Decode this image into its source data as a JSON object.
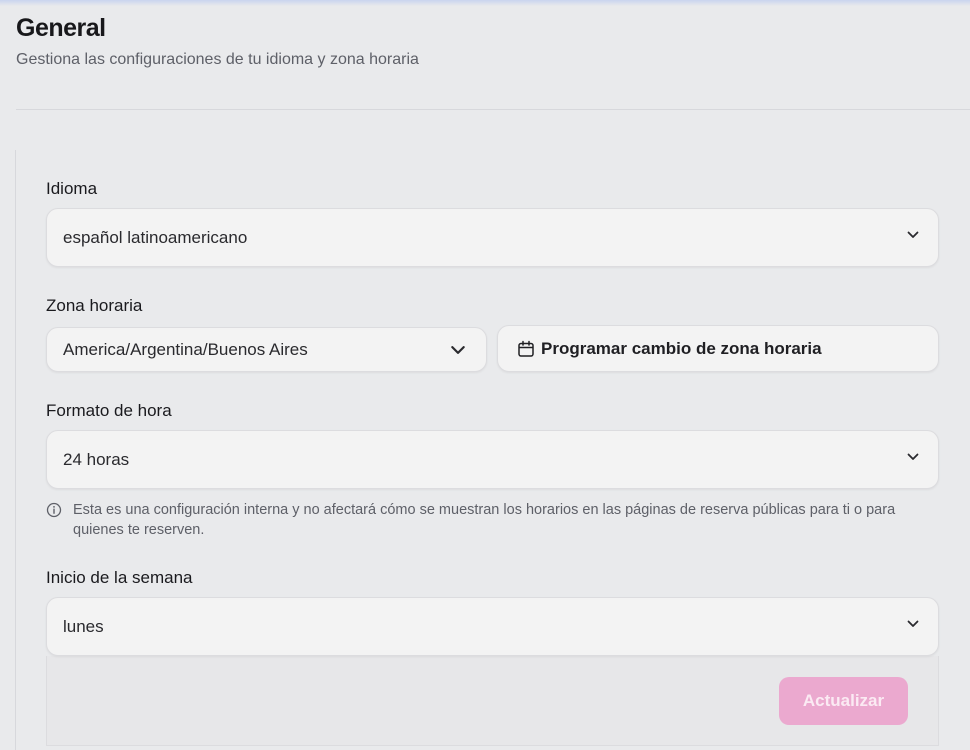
{
  "header": {
    "title": "General",
    "subtitle": "Gestiona las configuraciones de tu idioma y zona horaria"
  },
  "form": {
    "language": {
      "label": "Idioma",
      "value": "español latinoamericano"
    },
    "timezone": {
      "label": "Zona horaria",
      "value": "America/Argentina/Buenos Aires",
      "schedule_button": "Programar cambio de zona horaria"
    },
    "time_format": {
      "label": "Formato de hora",
      "value": "24 horas",
      "note": "Esta es una configuración interna y no afectará cómo se muestran los horarios en las páginas de reserva públicas para ti o para quienes te reserven."
    },
    "week_start": {
      "label": "Inicio de la semana",
      "value": "lunes"
    },
    "submit_label": "Actualizar"
  },
  "colors": {
    "background": "#e9eaec",
    "field": "#f3f3f3",
    "submit_disabled": "#eba9cf"
  },
  "icons": [
    "chevron-down-icon",
    "calendar-icon",
    "info-icon"
  ]
}
